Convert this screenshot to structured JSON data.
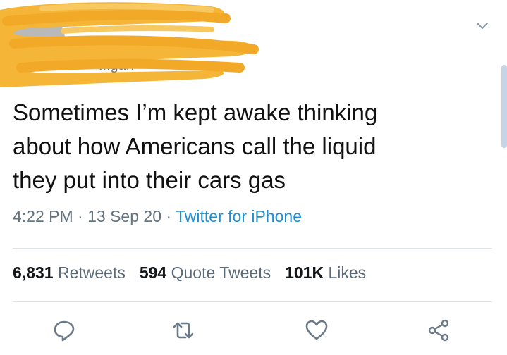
{
  "tweet": {
    "handle_partial": "...gan",
    "text": "Sometimes I’m kept awake thinking\nabout how Americans call the liquid\nthey put into their cars gas",
    "time": "4:22 PM",
    "date": "13 Sep 20",
    "separator": " · ",
    "source": "Twitter for iPhone"
  },
  "stats": {
    "retweets_count": "6,831",
    "retweets_label": "Retweets",
    "quotes_count": "594",
    "quotes_label": "Quote Tweets",
    "likes_count": "101K",
    "likes_label": "Likes"
  },
  "icons": {
    "chevron": "chevron-down-icon",
    "reply": "reply-icon",
    "retweet": "retweet-icon",
    "like": "heart-icon",
    "share": "share-icon"
  },
  "colors": {
    "scribble": "#f5b537",
    "link": "#1b8fd6",
    "secondary_text": "#647380",
    "icon": "#6b7a88"
  }
}
